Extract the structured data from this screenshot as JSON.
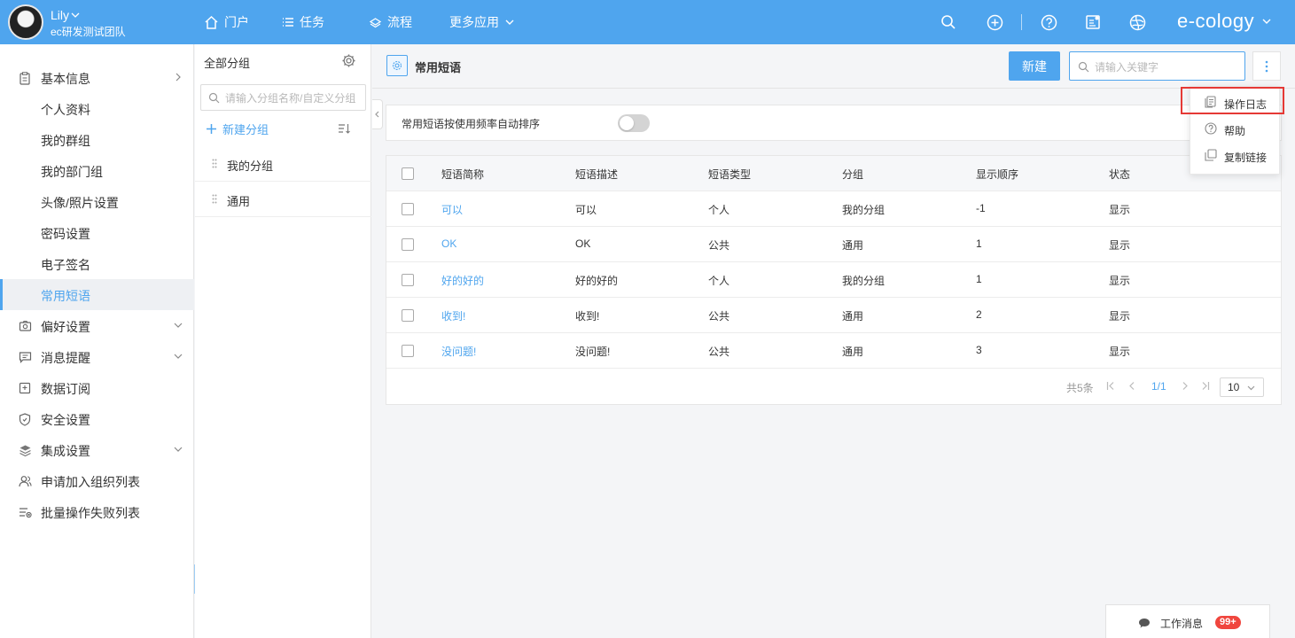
{
  "user": {
    "name": "Lily",
    "team": "ec研发测试团队"
  },
  "topnav": {
    "items": [
      {
        "label": "门户",
        "icon": "home-icon"
      },
      {
        "label": "任务",
        "icon": "list-icon"
      },
      {
        "label": "流程",
        "icon": "layers-icon"
      },
      {
        "label": "更多应用",
        "icon": "chevron-down-icon"
      }
    ],
    "brand": "e-cology"
  },
  "sidebar": {
    "items": [
      {
        "label": "基本信息",
        "icon": "clipboard-icon",
        "arrow": "right"
      },
      {
        "label": "个人资料"
      },
      {
        "label": "我的群组"
      },
      {
        "label": "我的部门组"
      },
      {
        "label": "头像/照片设置"
      },
      {
        "label": "密码设置"
      },
      {
        "label": "电子签名"
      },
      {
        "label": "常用短语",
        "active": true
      },
      {
        "label": "偏好设置",
        "icon": "camera-icon",
        "arrow": "down"
      },
      {
        "label": "消息提醒",
        "icon": "message-icon",
        "arrow": "down"
      },
      {
        "label": "数据订阅",
        "icon": "subscribe-icon"
      },
      {
        "label": "安全设置",
        "icon": "shield-icon"
      },
      {
        "label": "集成设置",
        "icon": "stack-icon",
        "arrow": "down"
      },
      {
        "label": "申请加入组织列表",
        "icon": "users-icon"
      },
      {
        "label": "批量操作失败列表",
        "icon": "failed-list-icon"
      }
    ]
  },
  "groups": {
    "title": "全部分组",
    "search_placeholder": "请输入分组名称/自定义分组",
    "new_group": "新建分组",
    "items": [
      {
        "label": "我的分组"
      },
      {
        "label": "通用"
      }
    ]
  },
  "main": {
    "title": "常用短语",
    "new_button": "新建",
    "search_placeholder": "请输入关键字",
    "sort_label": "常用短语按使用频率自动排序",
    "table": {
      "columns": [
        "短语简称",
        "短语描述",
        "短语类型",
        "分组",
        "显示顺序",
        "状态"
      ],
      "rows": [
        [
          "可以",
          "可以",
          "个人",
          "我的分组",
          "-1",
          "显示"
        ],
        [
          "OK",
          "OK",
          "公共",
          "通用",
          "1",
          "显示"
        ],
        [
          "好的好的",
          "好的好的",
          "个人",
          "我的分组",
          "1",
          "显示"
        ],
        [
          "收到!",
          "收到!",
          "公共",
          "通用",
          "2",
          "显示"
        ],
        [
          "没问题!",
          "没问题!",
          "公共",
          "通用",
          "3",
          "显示"
        ]
      ]
    },
    "pagination": {
      "total": "共5条",
      "current": "1/1",
      "page_size": "10"
    }
  },
  "dropdown": {
    "items": [
      {
        "label": "操作日志",
        "icon": "log-icon",
        "highlighted": true
      },
      {
        "label": "帮助",
        "icon": "help-icon"
      },
      {
        "label": "复制链接",
        "icon": "copy-icon"
      }
    ]
  },
  "messages": {
    "label": "工作消息",
    "badge": "99+"
  },
  "colors": {
    "accent": "#4fa5ee",
    "highlight_border": "#e53935",
    "badge": "#f0463e"
  }
}
